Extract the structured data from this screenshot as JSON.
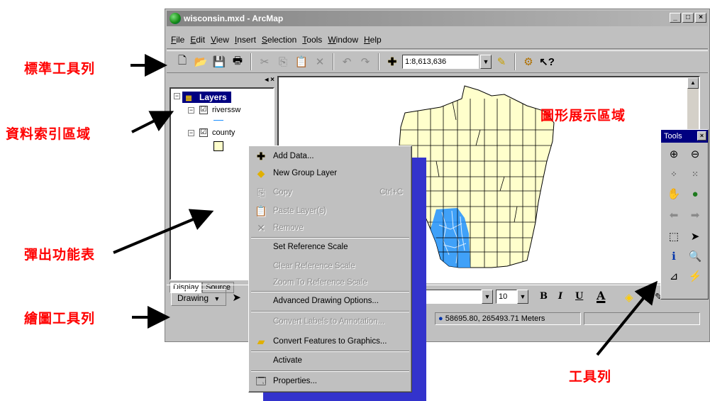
{
  "annotations": {
    "standard_toolbar": "標準工具列",
    "toc_area": "資料索引區域",
    "popup_menu": "彈出功能表",
    "drawing_toolbar": "繪圖工具列",
    "map_area": "圖形展示區域",
    "tools_toolbar": "工具列"
  },
  "window": {
    "title": "wisconsin.mxd - ArcMap",
    "buttons": [
      "_",
      "□",
      "×"
    ]
  },
  "menu": [
    "File",
    "Edit",
    "View",
    "Insert",
    "Selection",
    "Tools",
    "Window",
    "Help"
  ],
  "toolbar": {
    "scale": "1:8,613,636"
  },
  "toc": {
    "root_label": "Layers",
    "layers": [
      {
        "name": "riverssw",
        "checked": "☑"
      },
      {
        "name": "county",
        "checked": "☑"
      }
    ],
    "tabs": [
      "Display",
      "Source"
    ]
  },
  "context_menu": [
    {
      "label": "Add Data...",
      "enabled": true,
      "icon": "add-data-icon"
    },
    {
      "label": "New Group Layer",
      "enabled": true,
      "icon": "group-layer-icon"
    },
    {
      "label": "Copy",
      "enabled": false,
      "shortcut": "Ctrl+C",
      "icon": "copy-icon"
    },
    {
      "label": "Paste Layer(s)",
      "enabled": false,
      "icon": "paste-icon"
    },
    {
      "label": "Remove",
      "enabled": false,
      "icon": "remove-icon"
    },
    {
      "label": "Set Reference Scale",
      "enabled": true
    },
    {
      "label": "Clear Reference Scale",
      "enabled": false
    },
    {
      "label": "Zoom To Reference Scale",
      "enabled": false
    },
    {
      "label": "Advanced Drawing Options...",
      "enabled": true
    },
    {
      "label": "Convert Labels to Annotation...",
      "enabled": false
    },
    {
      "label": "Convert Features to Graphics...",
      "enabled": true,
      "icon": "convert-features-icon"
    },
    {
      "label": "Activate",
      "enabled": true
    },
    {
      "label": "Properties...",
      "enabled": true,
      "icon": "properties-icon"
    }
  ],
  "drawing_toolbar": {
    "label": "Drawing",
    "font_size": "10",
    "bold": "B",
    "italic": "I",
    "underline": "U",
    "font_color": "A"
  },
  "status": {
    "coordinates": "58695.80, 265493.71 Meters"
  },
  "tools_panel": {
    "title": "Tools",
    "close": "×"
  },
  "colors": {
    "annotation": "#ff0000",
    "county_fill": "#ffffcc",
    "river": "#1e90ff",
    "titlebar": "#848484",
    "selection": "#000080",
    "menu_shadow": "#3333cc"
  }
}
